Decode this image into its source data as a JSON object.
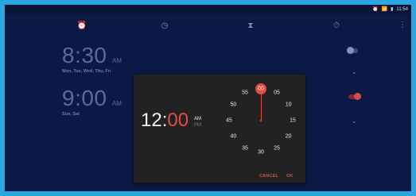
{
  "statusbar": {
    "time": "11:54",
    "icons": [
      "alarm-icon",
      "wifi-icon",
      "signal-icon",
      "battery-icon"
    ]
  },
  "tabs": [
    {
      "id": "alarm",
      "icon": "alarm-icon"
    },
    {
      "id": "clock",
      "icon": "clock-icon"
    },
    {
      "id": "timer",
      "icon": "hourglass-icon"
    },
    {
      "id": "stopwatch",
      "icon": "stopwatch-icon"
    }
  ],
  "menu_icon": "more-vert-icon",
  "alarms": [
    {
      "time": "8:30",
      "ampm": "AM",
      "days": "Mon, Tue, Wed, Thu, Fri",
      "enabled": false
    },
    {
      "time": "9:00",
      "ampm": "AM",
      "days": "Sun, Sat",
      "enabled": true
    }
  ],
  "dialog": {
    "hour": "12",
    "colon": ":",
    "minute": "00",
    "am": "AM",
    "pm": "PM",
    "dial_numbers": [
      "55",
      "00",
      "05",
      "50",
      "10",
      "45",
      "15",
      "40",
      "20",
      "35",
      "30",
      "25"
    ],
    "selected_minute": "00",
    "cancel_label": "CANCEL",
    "ok_label": "OK"
  },
  "colors": {
    "accent": "#e24c41",
    "background": "#0b1a45",
    "dialog": "#222222",
    "frame": "#2aa6e0"
  }
}
